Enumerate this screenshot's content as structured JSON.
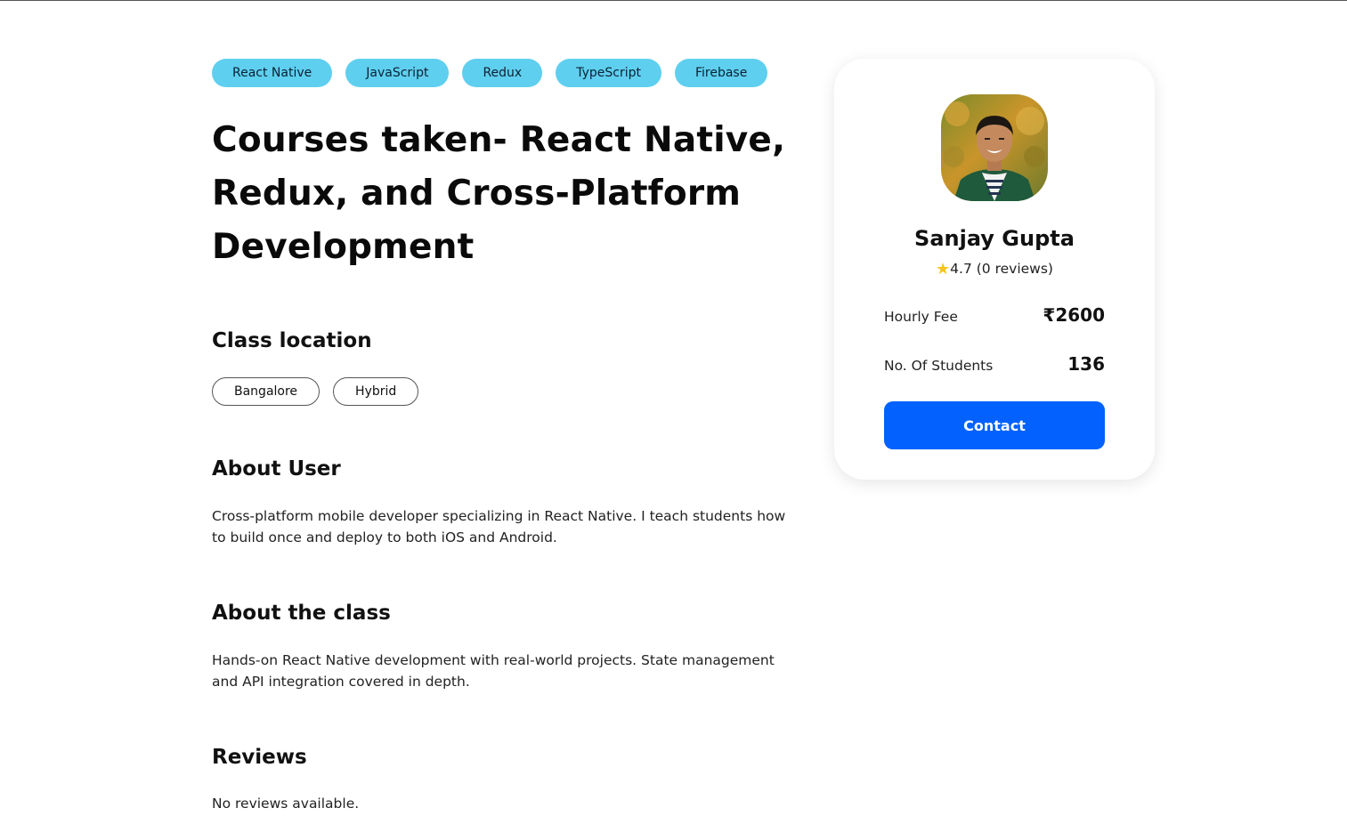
{
  "tags": [
    "React Native",
    "JavaScript",
    "Redux",
    "TypeScript",
    "Firebase"
  ],
  "course": {
    "title": "Courses taken- React Native, Redux, and Cross-Platform Development"
  },
  "class_location": {
    "heading": "Class location",
    "chips": [
      "Bangalore",
      "Hybrid"
    ]
  },
  "about_user": {
    "heading": "About User",
    "text": "Cross-platform mobile developer specializing in React Native. I teach students how to build once and deploy to both iOS and Android."
  },
  "about_class": {
    "heading": "About the class",
    "text": "Hands-on React Native development with real-world projects. State management and API integration covered in depth."
  },
  "reviews": {
    "heading": "Reviews",
    "empty_text": "No reviews available."
  },
  "tutor": {
    "name": "Sanjay Gupta",
    "star_icon": "star-icon",
    "rating_text": "4.7 (0 reviews)",
    "fee_label": "Hourly Fee",
    "fee_value": "₹2600",
    "students_label": "No. Of Students",
    "students_value": "136",
    "contact_label": "Contact"
  },
  "colors": {
    "tag_bg": "#5fcfef",
    "contact_bg": "#0362fe",
    "star": "#f5c518"
  }
}
